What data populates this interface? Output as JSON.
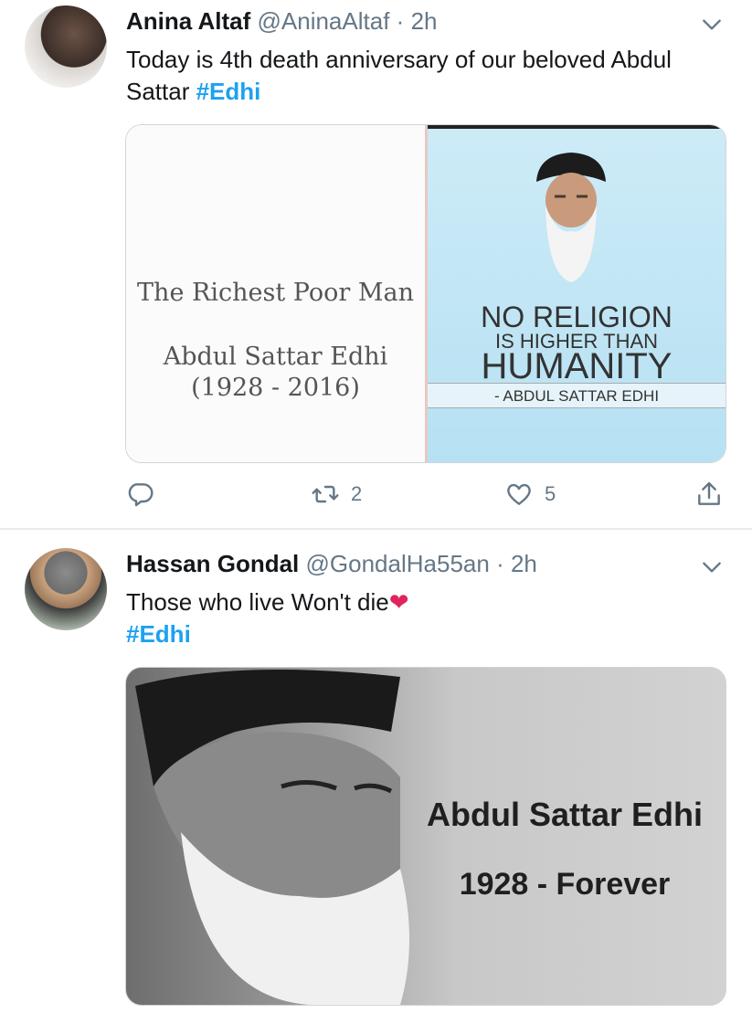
{
  "tweets": [
    {
      "name": "Anina Altaf",
      "handle": "@AninaAltaf",
      "separator": "·",
      "time": "2h",
      "text": "Today is 4th death anniversary of our beloved Abdul Sattar ",
      "hashtag": "#Edhi",
      "media": {
        "left_title": "The Richest Poor Man",
        "left_name": "Abdul Sattar Edhi",
        "left_years": "(1928 - 2016)",
        "quote_line1": "NO RELIGION",
        "quote_line2": "IS HIGHER THAN",
        "quote_line3": "HUMANITY",
        "quote_attrib": "- ABDUL SATTAR EDHI"
      },
      "actions": {
        "reply_count": "",
        "retweet_count": "2",
        "like_count": "5"
      }
    },
    {
      "name": "Hassan Gondal",
      "handle": "@GondalHa55an",
      "separator": "·",
      "time": "2h",
      "text": "Those who live Won't die",
      "emoji": "❤",
      "hashtag": "#Edhi",
      "media": {
        "title": "Abdul Sattar Edhi",
        "years": "1928 - Forever"
      }
    }
  ],
  "colors": {
    "accent": "#1da1f2",
    "secondary_text": "#657786",
    "heart": "#e0245e"
  }
}
